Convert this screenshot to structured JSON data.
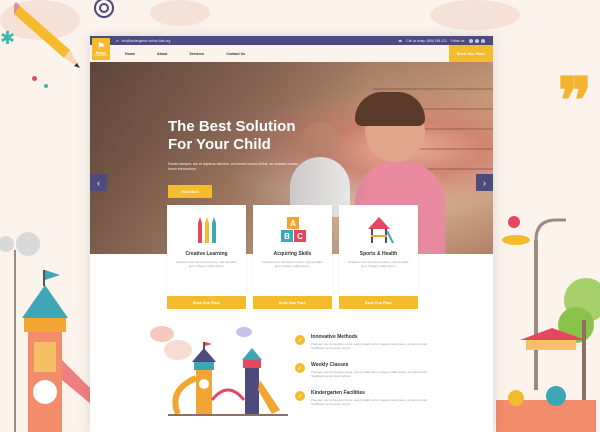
{
  "topbar": {
    "email": "info@kindergarten-school-kids.org",
    "phone": "Call us today: (555) 555-123",
    "follow": "Follow us:"
  },
  "brand": {
    "name": "Bridge",
    "tagline": "Kindergarten"
  },
  "nav": {
    "links": [
      "Home",
      "About",
      "Services",
      "Contact Us"
    ],
    "cta": "Book Your Place"
  },
  "hero": {
    "title_line1": "The Best Solution",
    "title_line2": "For Your Child",
    "text": "Donec semper, dui et dapibus ultricies, orci lorem cursus tellus, ac sodales massa lorem elementum.",
    "cta": "Read More"
  },
  "features": [
    {
      "title": "Creative Learning",
      "desc": "Praesent nec fermentum purus, sed convallis arcu. Integer mattis ipsum.",
      "button": "Book Your Place",
      "icon": "crayons-icon"
    },
    {
      "title": "Acquiring Skills",
      "desc": "Praesent nec fermentum purus, sed convallis arcu. Integer mattis ipsum.",
      "button": "Book Your Place",
      "icon": "abc-blocks-icon"
    },
    {
      "title": "Sports & Health",
      "desc": "Praesent nec fermentum purus, sed convallis arcu. Integer mattis ipsum.",
      "button": "Book Your Place",
      "icon": "playground-icon"
    }
  ],
  "benefits": [
    {
      "title": "Innovative Methods",
      "desc": "Praesent nec fermentum purus, sed convallis arcu. Integer mattis ipsum, at varius tortor. Vestibulum ante ipsum primis."
    },
    {
      "title": "Weekly Classes",
      "desc": "Praesent nec fermentum purus, sed convallis arcu. Integer mattis ipsum, at varius tortor. Vestibulum ante ipsum primis."
    },
    {
      "title": "Kindergarten Facilities",
      "desc": "Praesent nec fermentum purus, sed convallis arcu. Integer mattis ipsum, at varius tortor. Vestibulum ante ipsum primis."
    }
  ],
  "colors": {
    "accent": "#f4bb2c",
    "dark": "#4d4a7c",
    "background": "#fbf3ec"
  }
}
